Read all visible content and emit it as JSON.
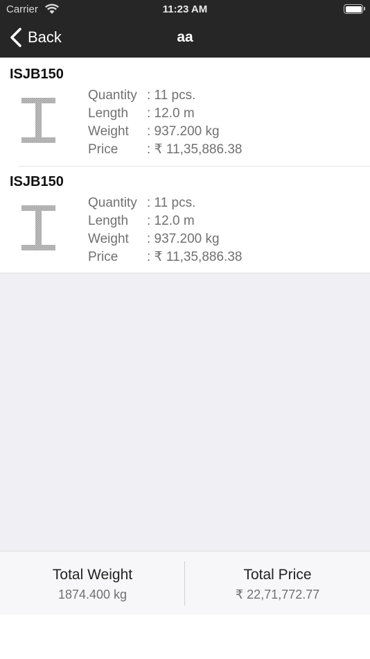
{
  "status_bar": {
    "carrier": "Carrier",
    "time": "11:23 AM",
    "wifi_icon": "wifi-icon",
    "battery_icon": "battery-icon"
  },
  "nav": {
    "back_label": "Back",
    "title": "aa",
    "back_icon": "chevron-left-icon"
  },
  "items": [
    {
      "title": "ISJB150",
      "icon": "i-beam-icon",
      "specs": [
        {
          "label": "Quantity",
          "value": ": 11 pcs."
        },
        {
          "label": "Length",
          "value": ": 12.0 m"
        },
        {
          "label": "Weight",
          "value": ": 937.200 kg"
        },
        {
          "label": "Price",
          "value": ": ₹ 11,35,886.38"
        }
      ]
    },
    {
      "title": "ISJB150",
      "icon": "i-beam-icon",
      "specs": [
        {
          "label": "Quantity",
          "value": ": 11 pcs."
        },
        {
          "label": "Length",
          "value": ": 12.0 m"
        },
        {
          "label": "Weight",
          "value": ": 937.200 kg"
        },
        {
          "label": "Price",
          "value": ": ₹ 11,35,886.38"
        }
      ]
    }
  ],
  "totals": {
    "weight_label": "Total Weight",
    "weight_value": "1874.400 kg",
    "price_label": "Total Price",
    "price_value": "₹ 22,71,772.77"
  },
  "colors": {
    "nav_bg": "#262626",
    "background": "#efeff4",
    "secondary_text": "#707070"
  }
}
